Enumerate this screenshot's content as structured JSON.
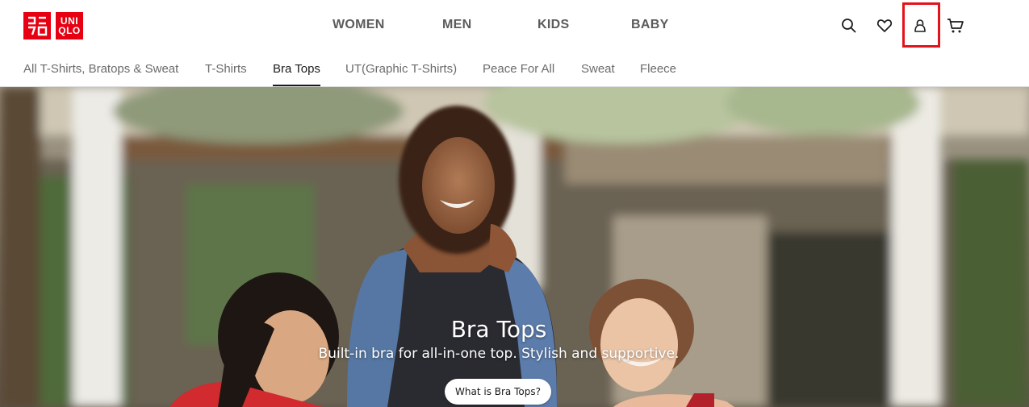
{
  "brand": {
    "logo_top": [
      "ユニ",
      "クロ"
    ],
    "logo_bottom": [
      "UNI",
      "QLO"
    ],
    "accent": "#e60012"
  },
  "main_nav": [
    {
      "label": "WOMEN"
    },
    {
      "label": "MEN"
    },
    {
      "label": "KIDS"
    },
    {
      "label": "BABY"
    }
  ],
  "header_icons": {
    "search": "search-icon",
    "wishlist": "heart-icon",
    "account": "user-icon",
    "cart": "cart-icon",
    "highlight_color": "#e3131b"
  },
  "sub_nav": {
    "items": [
      {
        "label": "All T-Shirts, Bratops & Sweat"
      },
      {
        "label": "T-Shirts"
      },
      {
        "label": "Bra Tops"
      },
      {
        "label": "UT(Graphic T-Shirts)"
      },
      {
        "label": "Peace For All"
      },
      {
        "label": "Sweat"
      },
      {
        "label": "Fleece"
      }
    ],
    "active_label": "Bra Tops"
  },
  "hero": {
    "title": "Bra Tops",
    "subtitle": "Built-in bra for all-in-one top. Stylish and supportive.",
    "cta_label": "What is Bra Tops?"
  }
}
